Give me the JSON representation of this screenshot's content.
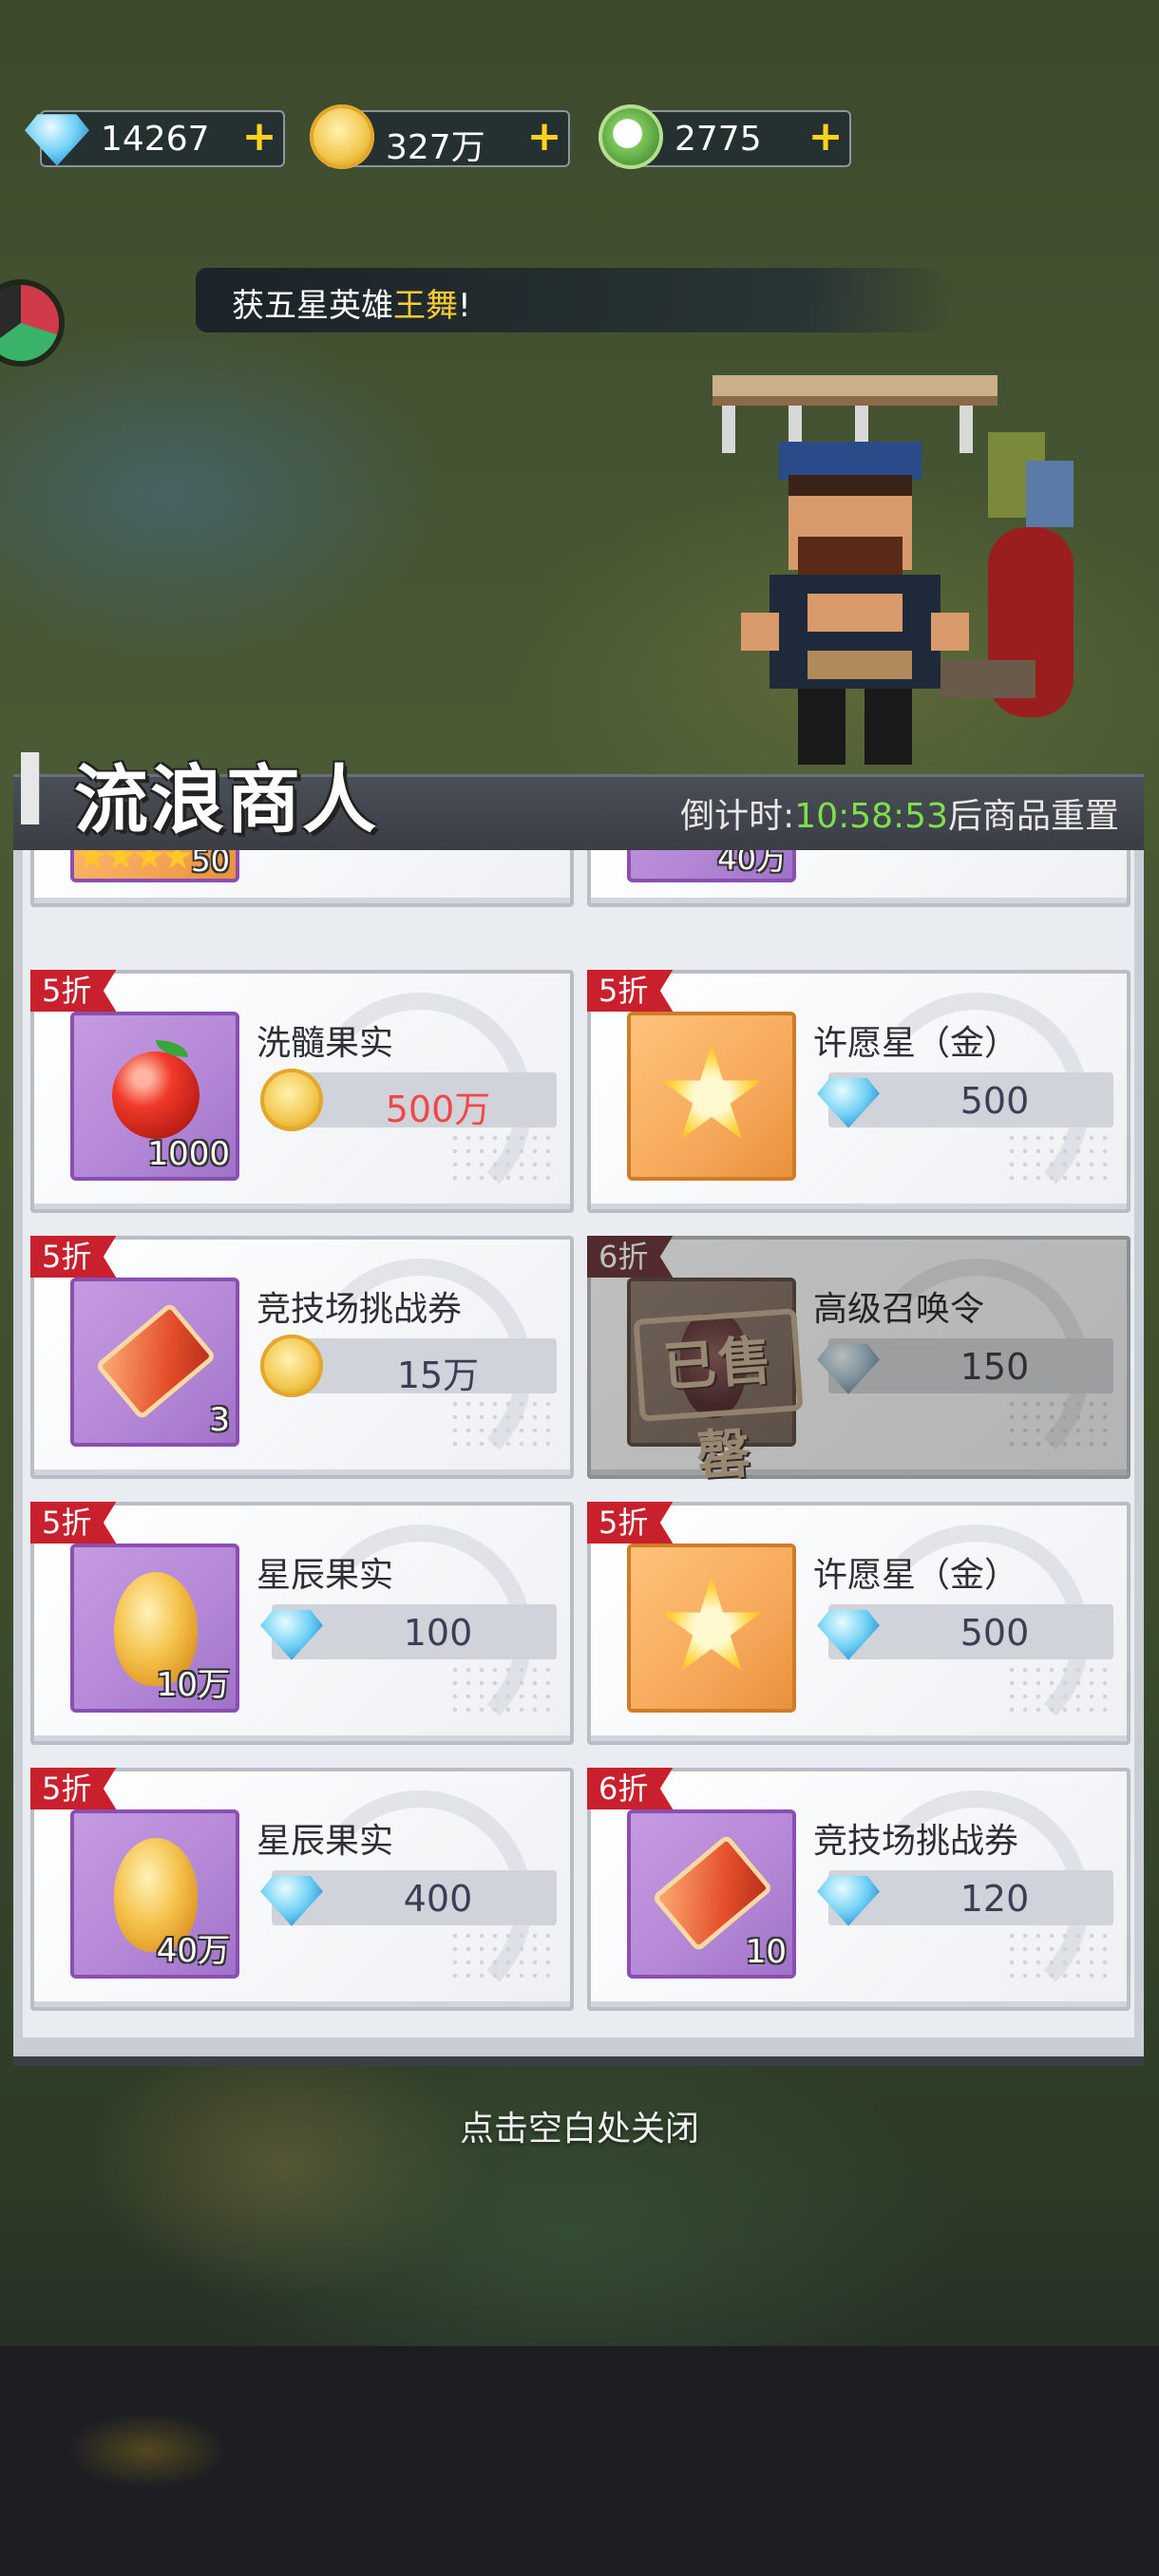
{
  "currencies": [
    {
      "name": "diamond",
      "icon": "diamond-icon",
      "value": "14267"
    },
    {
      "name": "gold",
      "icon": "gold-coin-icon",
      "value": "327万"
    },
    {
      "name": "frog",
      "icon": "frog-token-icon",
      "value": "2775"
    }
  ],
  "marquee": {
    "prefix": "获五星英雄",
    "highlight": "王舞",
    "suffix": "!"
  },
  "shop": {
    "title": "流浪商人",
    "countdown_prefix": "倒计时:",
    "countdown_time": "10:58:53",
    "countdown_suffix": "后商品重置",
    "partial_items": [
      {
        "count": "50"
      },
      {
        "count": "40万"
      }
    ],
    "items": [
      {
        "discount": "5折",
        "name": "洗髓果实",
        "count": "1000",
        "price": "500万",
        "currency": "gold-coin-icon",
        "art": "apple-icon",
        "sold": false
      },
      {
        "discount": "5折",
        "name": "许愿星（金）",
        "count": "",
        "price": "500",
        "currency": "diamond-icon",
        "art": "wish-star-icon",
        "sold": false
      },
      {
        "discount": "5折",
        "name": "竞技场挑战券",
        "count": "3",
        "price": "15万",
        "currency": "gold-coin-icon",
        "art": "ticket-icon",
        "sold": false
      },
      {
        "discount": "6折",
        "name": "高级召唤令",
        "count": "",
        "price": "150",
        "currency": "diamond-icon",
        "art": "summon-scroll-icon",
        "sold": true,
        "sold_label": "已售罄"
      },
      {
        "discount": "5折",
        "name": "星辰果实",
        "count": "10万",
        "price": "100",
        "currency": "diamond-icon",
        "art": "star-fruit-icon",
        "sold": false
      },
      {
        "discount": "5折",
        "name": "许愿星（金）",
        "count": "",
        "price": "500",
        "currency": "diamond-icon",
        "art": "wish-star-icon",
        "sold": false
      },
      {
        "discount": "5折",
        "name": "星辰果实",
        "count": "40万",
        "price": "400",
        "currency": "diamond-icon",
        "art": "star-fruit-icon",
        "sold": false
      },
      {
        "discount": "6折",
        "name": "竞技场挑战券",
        "count": "10",
        "price": "120",
        "currency": "diamond-icon",
        "art": "ticket-icon",
        "sold": false
      }
    ]
  },
  "close_hint": "点击空白处关闭",
  "colors": {
    "discount": "#c8202c",
    "countdown": "#7ee04a",
    "highlight": "#ffcc33",
    "price_gold": "#f04848"
  }
}
